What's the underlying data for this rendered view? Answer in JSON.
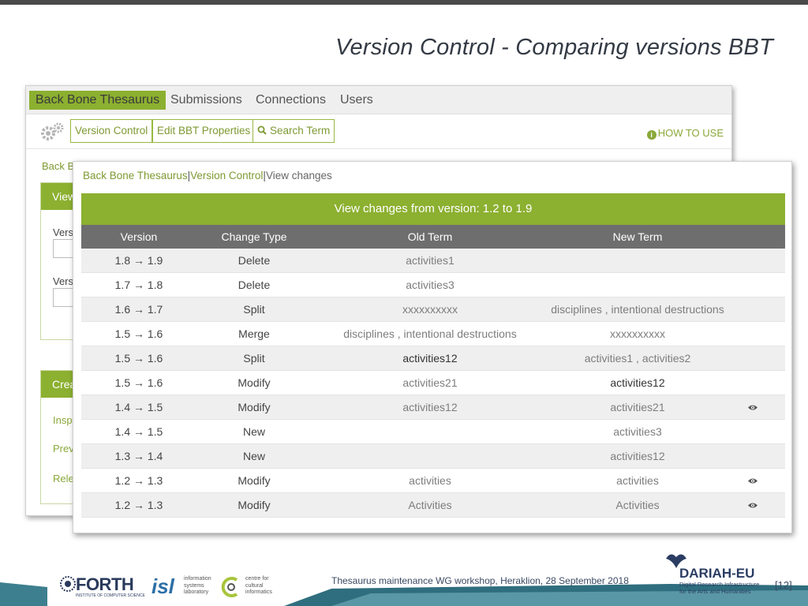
{
  "slide_title": "Version Control - Comparing versions BBT",
  "back_window": {
    "nav": [
      "Back Bone Thesaurus",
      "Submissions",
      "Connections",
      "Users"
    ],
    "toolbar": {
      "version_control": "Version Control",
      "edit_bbt": "Edit BBT Properties",
      "search_term": "Search Term",
      "how_to_use": "HOW TO USE"
    },
    "breadcrumb_partial": "Back Bo",
    "panel1_header_partial": "View",
    "field1_label_partial": "Versi",
    "field2_label_partial": "Versi",
    "panel2_header_partial": "Crea",
    "links_partial": [
      "Insp",
      "Prev",
      "Rele"
    ]
  },
  "front_window": {
    "breadcrumb": {
      "part1": "Back Bone Thesaurus",
      "sep": "|",
      "part2": "Version Control",
      "part3": "View changes"
    },
    "header": "View changes from version: 1.2 to 1.9",
    "columns": [
      "Version",
      "Change Type",
      "Old Term",
      "New Term"
    ],
    "rows": [
      {
        "version": "1.8 → 1.9",
        "change": "Delete",
        "old": "activities1",
        "new": "",
        "eye": false
      },
      {
        "version": "1.7 → 1.8",
        "change": "Delete",
        "old": "activities3",
        "new": "",
        "eye": false
      },
      {
        "version": "1.6 → 1.7",
        "change": "Split",
        "old": "xxxxxxxxxx",
        "new": "disciplines , intentional destructions",
        "eye": false
      },
      {
        "version": "1.5 → 1.6",
        "change": "Merge",
        "old": "disciplines , intentional destructions",
        "new": "xxxxxxxxxx",
        "eye": false
      },
      {
        "version": "1.5 → 1.6",
        "change": "Split",
        "old": "activities12",
        "new": "activities1 , activities2",
        "eye": false
      },
      {
        "version": "1.5 → 1.6",
        "change": "Modify",
        "old": "activities21",
        "new": "activities12",
        "eye": false
      },
      {
        "version": "1.4 → 1.5",
        "change": "Modify",
        "old": "activities12",
        "new": "activities21",
        "eye": true
      },
      {
        "version": "1.4 → 1.5",
        "change": "New",
        "old": "",
        "new": "activities3",
        "eye": false
      },
      {
        "version": "1.3 → 1.4",
        "change": "New",
        "old": "",
        "new": "activities12",
        "eye": false
      },
      {
        "version": "1.2 → 1.3",
        "change": "Modify",
        "old": "activities",
        "new": "activities",
        "eye": true
      },
      {
        "version": "1.2 → 1.3",
        "change": "Modify",
        "old": "Activities",
        "new": "Activities",
        "eye": true
      }
    ]
  },
  "footer": {
    "text": "Thesaurus maintenance WG workshop, Heraklion, 28 September 2018",
    "page": "[12]",
    "forth": "FORTH",
    "forth_sub": "INSTITUTE OF COMPUTER SCIENCE",
    "isl": "isl",
    "isl_text": [
      "information",
      "systems",
      "laboratory"
    ],
    "cci_text": [
      "centre for",
      "cultural",
      "informatics"
    ],
    "dariah": "DARIAH-EU",
    "dariah_sub": [
      "Digital Research Infrastructure",
      "for the Arts and Humanities"
    ]
  },
  "colors": {
    "accent_green": "#8cb030",
    "table_header_gray": "#6e6e6e",
    "title_color": "#333a44"
  }
}
